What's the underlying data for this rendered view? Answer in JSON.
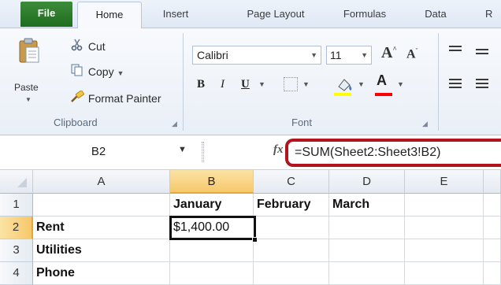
{
  "ribbon_tabs": [
    "File",
    "Home",
    "Insert",
    "Page Layout",
    "Formulas",
    "Data",
    "R"
  ],
  "clipboard": {
    "paste_label": "Paste",
    "cut_label": "Cut",
    "copy_label": "Copy",
    "format_painter_label": "Format Painter",
    "group_label": "Clipboard"
  },
  "font": {
    "font_name": "Calibri",
    "font_size": "11",
    "group_label": "Font",
    "bold": "B",
    "italic": "I",
    "underline": "U",
    "grow_font": "A",
    "shrink_font": "A",
    "font_color_glyph": "A"
  },
  "formula_bar": {
    "name_box": "B2",
    "fx": "fx",
    "formula": "=SUM(Sheet2:Sheet3!B2)"
  },
  "grid": {
    "columns": [
      "A",
      "B",
      "C",
      "D",
      "E"
    ],
    "rows": [
      "1",
      "2",
      "3",
      "4"
    ],
    "selected_column": "B",
    "selected_row": "2",
    "cells": {
      "B1": "January",
      "C1": "February",
      "D1": "March",
      "A2": "Rent",
      "B2": "$1,400.00",
      "A3": "Utilities",
      "A4": "Phone"
    }
  },
  "colors": {
    "file_tab": "#2b7a2b",
    "selection_highlight": "#f7c86a",
    "formula_callout": "#b3141b",
    "fill_color": "#ffff00",
    "font_color": "#ff0000"
  },
  "icons": [
    "cut-icon",
    "copy-icon",
    "format-painter-icon",
    "paste-icon",
    "fx-icon",
    "fill-color-icon",
    "borders-icon",
    "align-icon"
  ]
}
